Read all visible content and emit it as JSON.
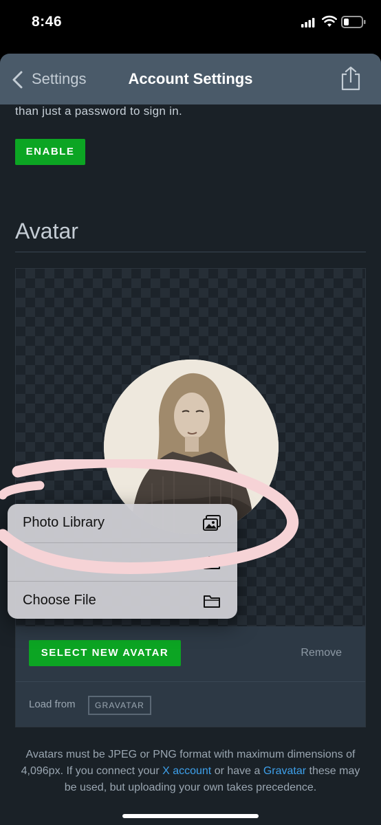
{
  "status_bar": {
    "time": "8:46"
  },
  "nav": {
    "back_label": "Settings",
    "title": "Account Settings"
  },
  "two_factor": {
    "description_tail": "than just a password to sign in.",
    "enable_label": "ENABLE"
  },
  "avatar": {
    "heading": "Avatar",
    "select_label": "SELECT NEW AVATAR",
    "remove_label": "Remove",
    "load_from_label": "Load from",
    "gravatar_label": "GRAVATAR"
  },
  "menu": {
    "items": [
      {
        "label": "Photo Library",
        "icon": "photo-library-icon"
      },
      {
        "label": "",
        "icon": "camera-icon"
      },
      {
        "label": "Choose File",
        "icon": "folder-icon"
      }
    ]
  },
  "help": {
    "part1": "Avatars must be ",
    "jpeg": "JPEG",
    "part2": " or ",
    "png": "PNG",
    "part3": " format with maximum dimensions of 4,096px. If you connect your ",
    "x_account_link": "X account",
    "part4": " or have a ",
    "gravatar_link": "Gravatar",
    "part5": " these may be used, but uploading your own takes precedence."
  },
  "colors": {
    "accent_green": "#0ca523",
    "link_blue": "#3ea0ea",
    "nav_bar": "#4a5a69",
    "background": "#1a2127",
    "marker_pink": "#f6d3d6"
  }
}
